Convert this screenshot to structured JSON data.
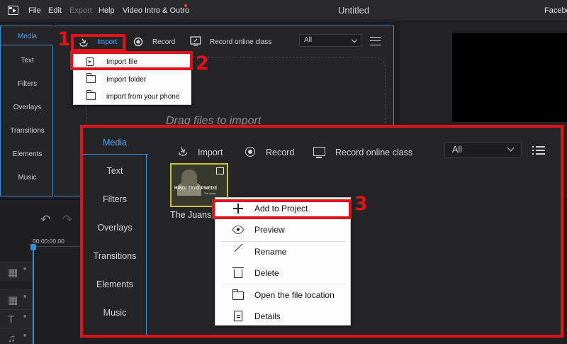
{
  "titlebar": {
    "menus": [
      "File",
      "Edit",
      "Export",
      "Help",
      "Video Intro & Outro"
    ],
    "title": "Untitled",
    "right_cut": "Faceboo"
  },
  "sidebar": {
    "items": [
      "Media",
      "Text",
      "Filters",
      "Overlays",
      "Transitions",
      "Elements",
      "Music"
    ]
  },
  "toolbar": {
    "import": "Import",
    "record": "Record",
    "record_online": "Record online class",
    "filter_value": "All"
  },
  "import_menu": {
    "items": [
      "Import file",
      "Import folder",
      "import from your phone"
    ]
  },
  "drop_zone": {
    "text": "Drag files to import"
  },
  "timeline": {
    "time": "00:00:00.00"
  },
  "annotations": {
    "n1": "1",
    "n2": "2",
    "n3": "3"
  },
  "inset": {
    "sidebar": [
      "Media",
      "Text",
      "Filters",
      "Overlays",
      "Transitions",
      "Elements",
      "Music"
    ],
    "toolbar": {
      "import": "Import",
      "record": "Record",
      "record_online": "Record online class",
      "filter_value": "All"
    },
    "thumbnail": {
      "overlay_text": "HINDI TAYO PWEDE",
      "overlay_sub": "The Juans",
      "name": "The Juans"
    },
    "context_menu": {
      "items": [
        "Add to Project",
        "Preview",
        "Rename",
        "Delete",
        "Open the file location",
        "Details"
      ]
    }
  },
  "colors": {
    "accent": "#3a8ed4",
    "annotation_red": "#e0131d",
    "background": "#1d1d1f"
  }
}
